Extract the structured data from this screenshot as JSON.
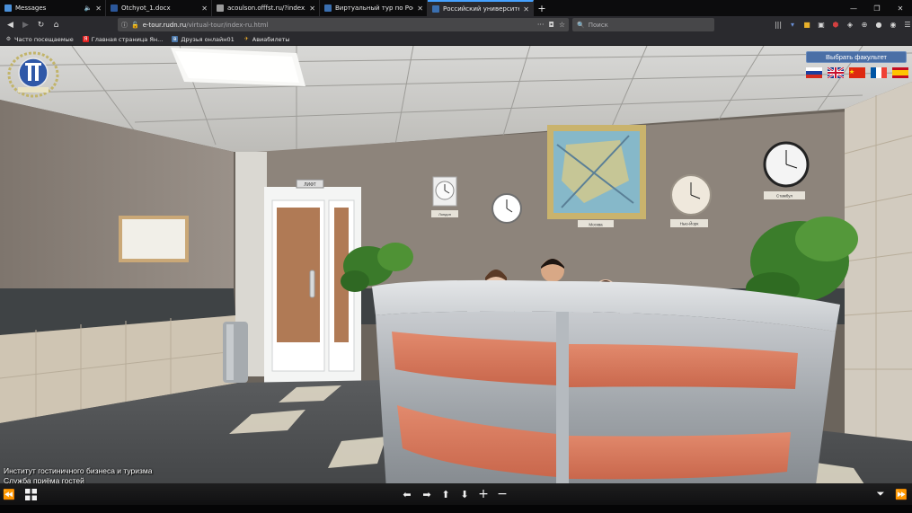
{
  "tabs": [
    {
      "title": "Messages",
      "favicon_color": "#4a90d9",
      "audio": true,
      "active": false
    },
    {
      "title": "Otchyot_1.docx",
      "favicon_color": "#2b579a",
      "audio": false,
      "active": false
    },
    {
      "title": "acoulson.offfst.ru/?index.html",
      "favicon_color": "#9a9a9a",
      "audio": false,
      "active": false
    },
    {
      "title": "Виртуальный тур по Российск...",
      "favicon_color": "#3a6fb0",
      "audio": false,
      "active": false
    },
    {
      "title": "Российский университет дру...",
      "favicon_color": "#3a6fb0",
      "audio": false,
      "active": true
    }
  ],
  "navbar": {
    "url_domain": "e-tour.rudn.ru",
    "url_path": "/virtual-tour/index-ru.html",
    "search_placeholder": "Поиск"
  },
  "bookmarks": [
    {
      "label": "Часто посещаемые",
      "icon_color": "#d6d6d6"
    },
    {
      "label": "Главная страница Ян...",
      "icon_color": "#e02020"
    },
    {
      "label": "Друзья онлайн01",
      "icon_color": "#4a76a8"
    },
    {
      "label": "Авиабилеты",
      "icon_color": "#f3b02a"
    }
  ],
  "tour": {
    "faculty_button": "Выбрать факультет",
    "signs": {
      "elevator": "ЛИФТ",
      "city_moscow": "Москва",
      "city_london": "Лондон",
      "city_newyork": "Нью-Йорк",
      "city_istanbul": "Стамбул"
    },
    "caption_line1": "Институт гостиничного бизнеса и туризма",
    "caption_line2": "Служба приёма гостей",
    "languages": [
      {
        "code": "ru",
        "name": "Русский"
      },
      {
        "code": "en",
        "name": "English"
      },
      {
        "code": "zh",
        "name": "中文"
      },
      {
        "code": "fr",
        "name": "Français"
      },
      {
        "code": "es",
        "name": "Español"
      }
    ]
  },
  "colors": {
    "accent": "#45a1ff",
    "faculty_button": "#4a6fa6",
    "desk_orange": "#d97a5e",
    "wall": "#8a8078"
  }
}
